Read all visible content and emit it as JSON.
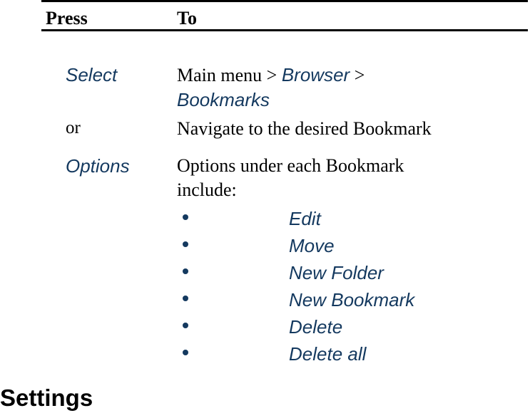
{
  "table": {
    "headers": {
      "press": "Press",
      "to": "To"
    },
    "rows": [
      {
        "label": "Select",
        "label_style": "blue-italic",
        "text_parts": [
          {
            "text": "Main",
            "style": "plain"
          },
          {
            "text": "menu",
            "style": "plain"
          },
          {
            "text": ">",
            "style": "plain"
          },
          {
            "text": "Browser",
            "style": "blue-italic"
          },
          {
            "text": ">",
            "style": "plain"
          },
          {
            "text": "Bookmarks",
            "style": "blue-italic"
          }
        ],
        "line1": "Main menu > Browser >",
        "line2": "Bookmarks"
      },
      {
        "label": "or",
        "label_style": "plain",
        "line1": "Navigate to the    desired Bookmark"
      },
      {
        "label": "Options",
        "label_style": "blue-italic",
        "line1": "Options under each Bookmark",
        "line2": "include:",
        "bullets": [
          "Edit",
          "Move",
          "New Folder",
          "New Bookmark",
          "Delete",
          "Delete all"
        ]
      }
    ]
  },
  "headings": {
    "settings": "Settings"
  },
  "colors": {
    "accent_blue": "#14395f",
    "text_black": "#000000",
    "background": "#ffffff"
  }
}
